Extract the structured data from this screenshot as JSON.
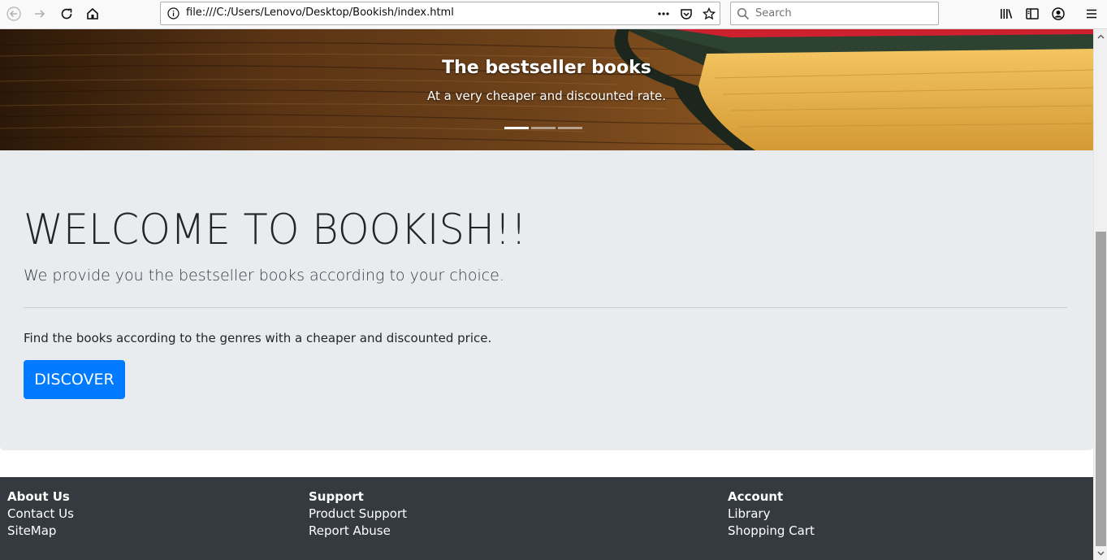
{
  "browser": {
    "url": "file:///C:/Users/Lenovo/Desktop/Bookish/index.html",
    "search_placeholder": "Search",
    "icons": [
      "back-icon",
      "forward-icon",
      "reload-icon",
      "home-icon",
      "info-icon",
      "more-icon",
      "pocket-icon",
      "bookmark-star-icon",
      "search-icon",
      "library-icon",
      "sidebar-icon",
      "account-icon",
      "menu-icon"
    ]
  },
  "carousel": {
    "title": "The bestseller books",
    "subtitle": "At a very cheaper and discounted rate.",
    "indicator_count": 3,
    "active_index": 0
  },
  "jumbotron": {
    "heading": "WELCOME TO BOOKISH!!",
    "lead": "We provide you the bestseller books according to your choice.",
    "paragraph": "Find the books according to the genres with a cheaper and discounted price.",
    "button_label": "DISCOVER"
  },
  "footer": {
    "columns": [
      {
        "heading": "About Us",
        "links": [
          "Contact Us",
          "SiteMap"
        ]
      },
      {
        "heading": "Support",
        "links": [
          "Product Support",
          "Report Abuse"
        ]
      },
      {
        "heading": "Account",
        "links": [
          "Library",
          "Shopping Cart"
        ]
      }
    ]
  },
  "colors": {
    "primary": "#007bff",
    "jumbotron_bg": "#e9ecef",
    "footer_bg": "#343a40"
  }
}
